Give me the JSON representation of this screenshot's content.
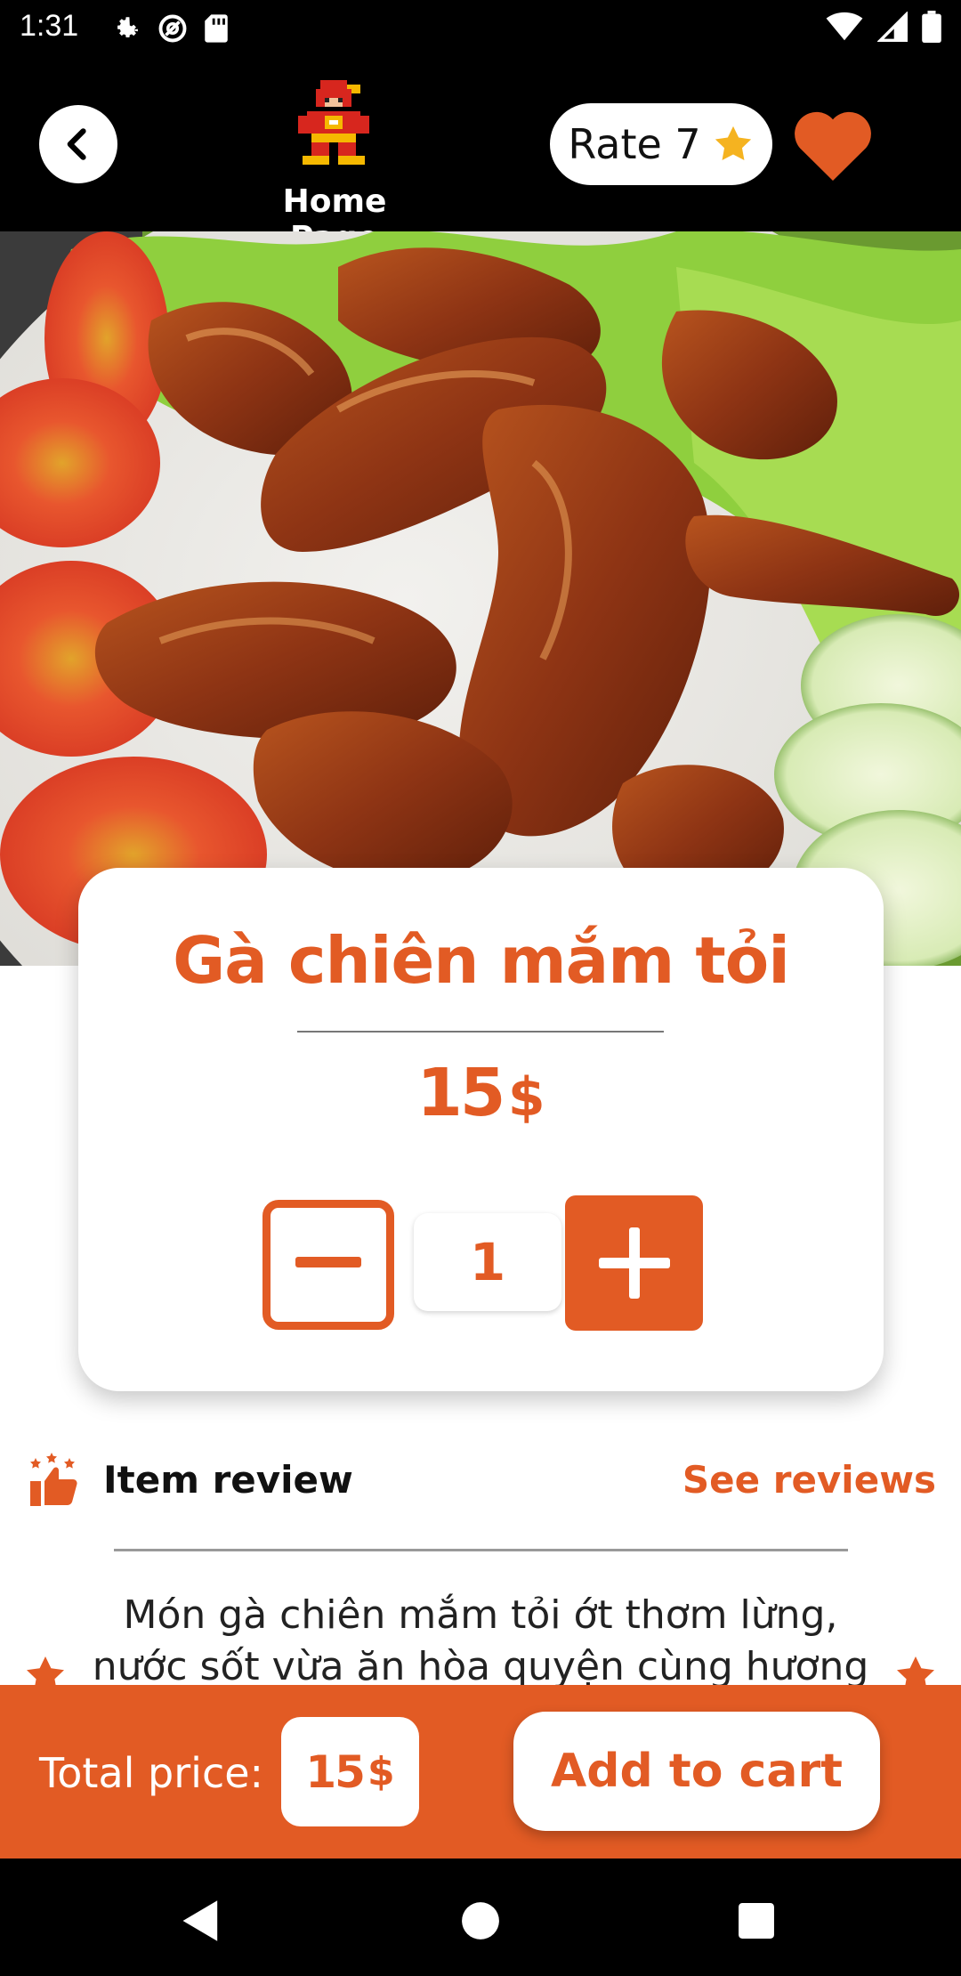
{
  "status_bar": {
    "time": "1:31",
    "icons_left": [
      "gear-icon",
      "at-sign-icon",
      "sd-card-icon"
    ],
    "icons_right": [
      "wifi-icon",
      "signal-icon",
      "battery-icon"
    ]
  },
  "header": {
    "home_label": "Home Page",
    "rate_label": "Rate 7",
    "back_icon": "chevron-left-icon",
    "favorite_icon": "heart-icon"
  },
  "product": {
    "name": "Gà chiên mắm tỏi",
    "price_value": "15",
    "price_currency": "$",
    "quantity": "1"
  },
  "review": {
    "title": "Item review",
    "see_reviews_label": "See reviews",
    "description": "Món gà chiên mắm tỏi ớt thơm lừng, nước sốt vừa ăn hòa quyện cùng hương"
  },
  "bottom_bar": {
    "total_label": "Total price:",
    "total_value": "15",
    "total_currency": "$",
    "add_to_cart_label": "Add to cart"
  },
  "colors": {
    "accent": "#e25b24",
    "background_dark": "#000000"
  }
}
